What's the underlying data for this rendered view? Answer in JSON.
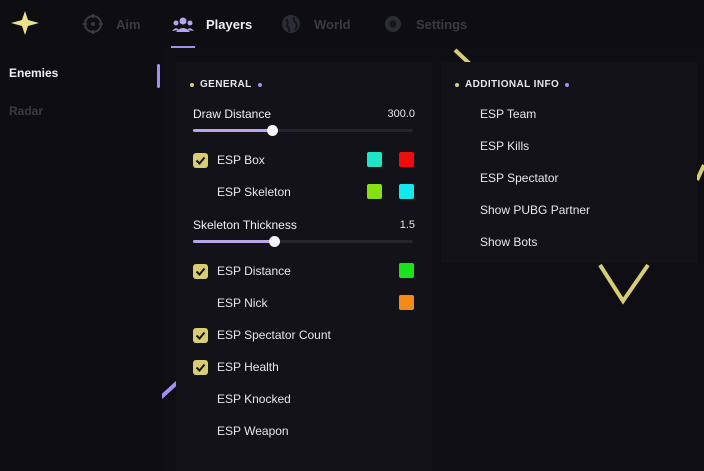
{
  "nav": {
    "logo_icon": "star-sparkle-icon",
    "tabs": [
      {
        "label": "Aim",
        "icon": "crosshair-icon",
        "active": false
      },
      {
        "label": "Players",
        "icon": "players-icon",
        "active": true
      },
      {
        "label": "World",
        "icon": "globe-icon",
        "active": false
      },
      {
        "label": "Settings",
        "icon": "gear-icon",
        "active": false
      }
    ]
  },
  "sidebar": {
    "items": [
      {
        "label": "Enemies",
        "active": true
      },
      {
        "label": "Radar",
        "active": false
      }
    ]
  },
  "general": {
    "title": "GENERAL",
    "draw_distance": {
      "label": "Draw Distance",
      "value": "300.0",
      "level": 0.36
    },
    "skeleton_thickness": {
      "label": "Skeleton Thickness",
      "value": "1.5",
      "level": 0.37
    },
    "options": [
      {
        "label": "ESP Box",
        "checked": true,
        "colors": [
          "#1de6c6",
          "#ee0d0d"
        ]
      },
      {
        "label": "ESP Skeleton",
        "checked": false,
        "colors": [
          "#84e30e",
          "#14e8ef"
        ]
      },
      {
        "label": "ESP Distance",
        "checked": true,
        "colors": [
          "#17e51a"
        ]
      },
      {
        "label": "ESP Nick",
        "checked": false,
        "colors": [
          "#f58a16"
        ]
      },
      {
        "label": "ESP Spectator Count",
        "checked": true,
        "colors": []
      },
      {
        "label": "ESP Health",
        "checked": true,
        "colors": []
      },
      {
        "label": "ESP Knocked",
        "checked": false,
        "colors": []
      },
      {
        "label": "ESP Weapon",
        "checked": false,
        "colors": []
      }
    ]
  },
  "additional": {
    "title": "ADDITIONAL INFO",
    "items": [
      "ESP Team",
      "ESP Kills",
      "ESP Spectator",
      "Show PUBG Partner",
      "Show Bots"
    ]
  },
  "colors": {
    "accent_purple": "#a48ff0",
    "accent_yellow": "#d8cd72",
    "background": "#0e0e14",
    "panel": "#121218"
  }
}
